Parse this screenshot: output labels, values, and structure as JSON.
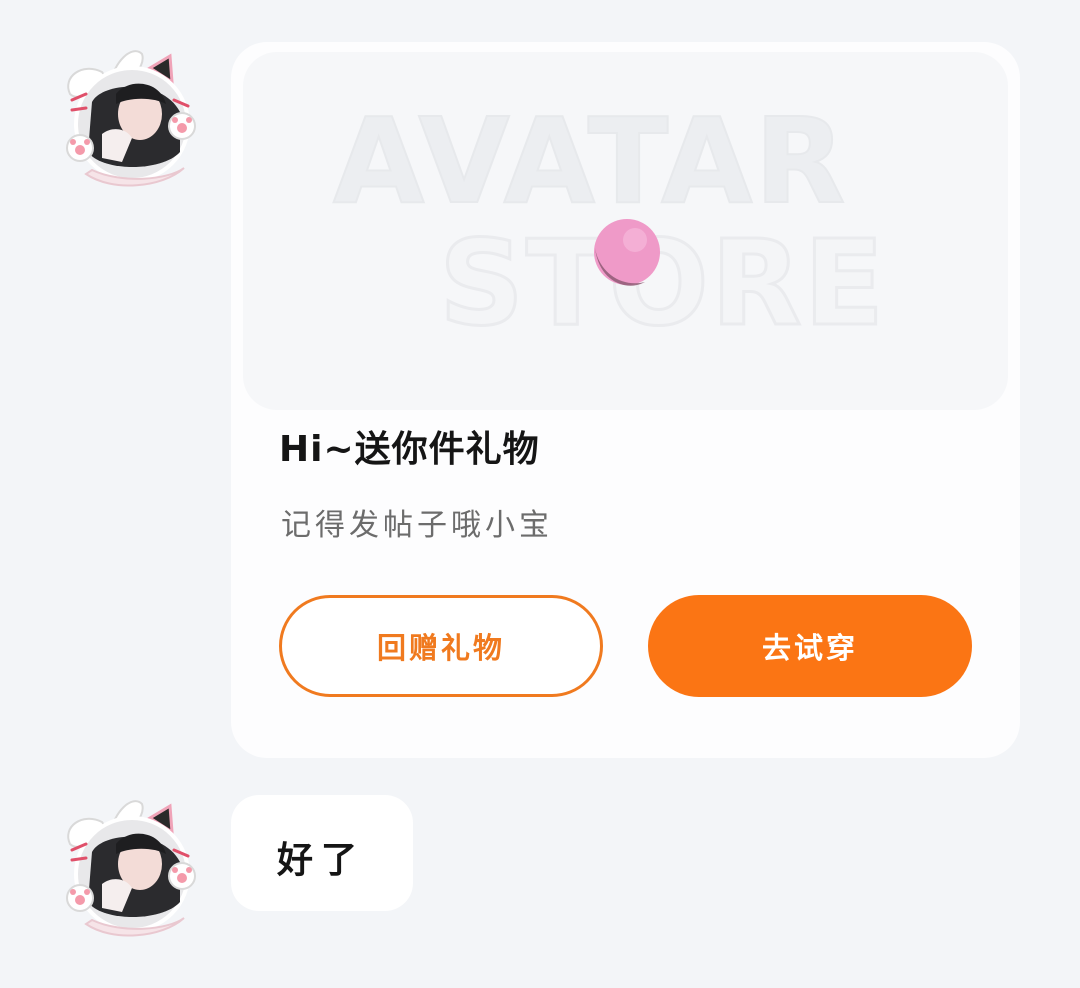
{
  "messages": [
    {
      "type": "gift-card",
      "banner": {
        "line1": "AVATAR",
        "line2": "STORE"
      },
      "title": "Hi~送你件礼物",
      "subtitle": "记得发帖子哦小宝",
      "buttons": {
        "return_gift": "回赠礼物",
        "try_on": "去试穿"
      }
    },
    {
      "type": "text",
      "text": "好了"
    }
  ],
  "colors": {
    "accent": "#fb7514",
    "accent_outline": "#f07a1f",
    "background": "#f3f5f8",
    "card": "#fdfdfe",
    "orb": "#ef9ac8"
  },
  "icons": {
    "avatar": "avatar-cat-ears-image",
    "banner_orb": "pink-orb-icon"
  }
}
